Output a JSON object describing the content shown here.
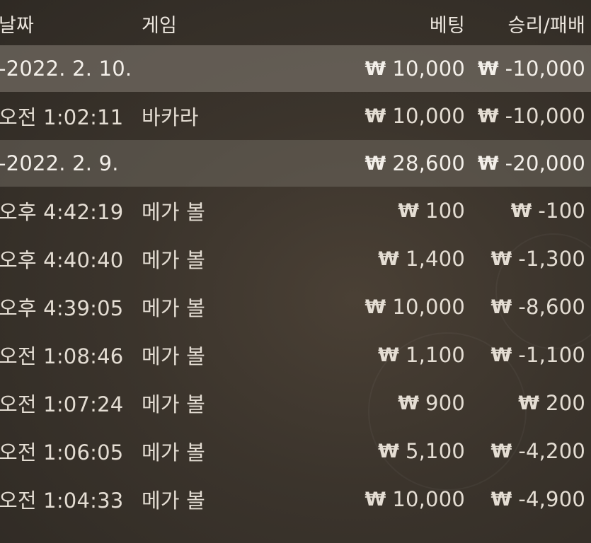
{
  "header": {
    "date": "날짜",
    "game": "게임",
    "bet": "베팅",
    "result": "승리/패배"
  },
  "currency_symbol": "₩",
  "rows": [
    {
      "type": "group",
      "date": "-2022. 2. 10.",
      "game": "",
      "bet": "10,000",
      "result": "-10,000"
    },
    {
      "type": "entry",
      "date": "오전 1:02:11",
      "game": "바카라",
      "bet": "10,000",
      "result": "-10,000"
    },
    {
      "type": "group",
      "date": "-2022. 2. 9.",
      "game": "",
      "bet": "28,600",
      "result": "-20,000"
    },
    {
      "type": "entry",
      "date": "오후 4:42:19",
      "game": "메가 볼",
      "bet": "100",
      "result": "-100"
    },
    {
      "type": "entry",
      "date": "오후 4:40:40",
      "game": "메가 볼",
      "bet": "1,400",
      "result": "-1,300"
    },
    {
      "type": "entry",
      "date": "오후 4:39:05",
      "game": "메가 볼",
      "bet": "10,000",
      "result": "-8,600"
    },
    {
      "type": "entry",
      "date": "오전 1:08:46",
      "game": "메가 볼",
      "bet": "1,100",
      "result": "-1,100"
    },
    {
      "type": "entry",
      "date": "오전 1:07:24",
      "game": "메가 볼",
      "bet": "900",
      "result": "200"
    },
    {
      "type": "entry",
      "date": "오전 1:06:05",
      "game": "메가 볼",
      "bet": "5,100",
      "result": "-4,200"
    },
    {
      "type": "entry",
      "date": "오전 1:04:33",
      "game": "메가 볼",
      "bet": "10,000",
      "result": "-4,900"
    }
  ]
}
